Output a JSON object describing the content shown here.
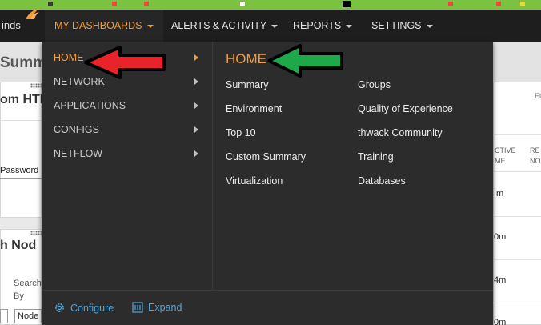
{
  "brand": {
    "text": "inds"
  },
  "nav": {
    "items": [
      {
        "label": "MY DASHBOARDS"
      },
      {
        "label": "ALERTS & ACTIVITY"
      },
      {
        "label": "REPORTS"
      },
      {
        "label": "SETTINGS"
      }
    ]
  },
  "page": {
    "title": "Summ",
    "panel1_title": "om HTM",
    "password_label": "Password",
    "panel2_title": "h Nod",
    "search_label": "Search",
    "by_label": "By",
    "node_value": "Node",
    "col_active": [
      "CTIVE",
      "ME"
    ],
    "col_rec": [
      "RE",
      "NO"
    ],
    "col_el": "El",
    "cells": [
      "m",
      "0m",
      "4m",
      "0m"
    ]
  },
  "menu": {
    "categories": [
      {
        "label": "HOME"
      },
      {
        "label": "NETWORK"
      },
      {
        "label": "APPLICATIONS"
      },
      {
        "label": "CONFIGS"
      },
      {
        "label": "NETFLOW"
      }
    ],
    "heading": "HOME",
    "links_col1": [
      "Summary",
      "Environment",
      "Top 10",
      "Custom Summary",
      "Virtualization"
    ],
    "links_col2": [
      "Groups",
      "Quality of Experience",
      "thwack Community",
      "Training",
      "Databases"
    ],
    "footer": {
      "configure": "Configure",
      "expand": "Expand"
    }
  },
  "colors": {
    "accent": "#f39c34",
    "menu_bg": "#2c2c2c",
    "nav_bg": "#1e1e1e",
    "link_blue": "#4ea6dc",
    "red_arrow": "#e8232a",
    "green_arrow": "#1fa84a"
  },
  "icons": {
    "configure": "gear-icon",
    "expand": "expand-icon"
  }
}
